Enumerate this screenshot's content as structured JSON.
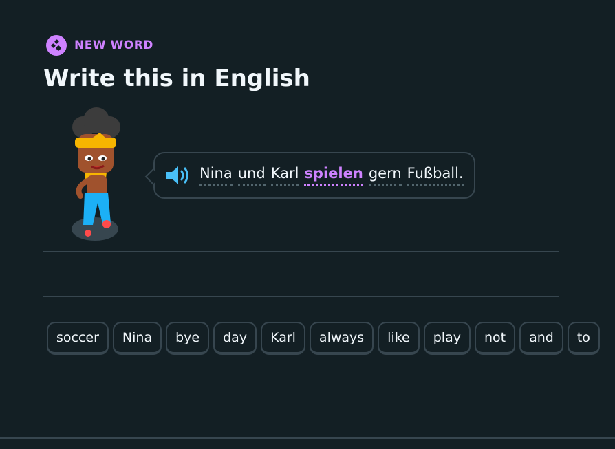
{
  "badge": {
    "label": "NEW WORD",
    "icon": "new-word-icon",
    "color": "#ce82ff"
  },
  "title": "Write this in English",
  "prompt": {
    "speaker_icon": "speaker-icon",
    "words": [
      "Nina",
      "und",
      "Karl",
      "spielen",
      "gern",
      "Fußball."
    ],
    "highlighted_word": "spielen"
  },
  "word_bank": [
    "soccer",
    "Nina",
    "bye",
    "day",
    "Karl",
    "always",
    "like",
    "play",
    "not",
    "and",
    "to"
  ],
  "colors": {
    "background": "#131f24",
    "accent": "#ce82ff",
    "border": "#37464f",
    "speaker": "#49c0f8"
  }
}
